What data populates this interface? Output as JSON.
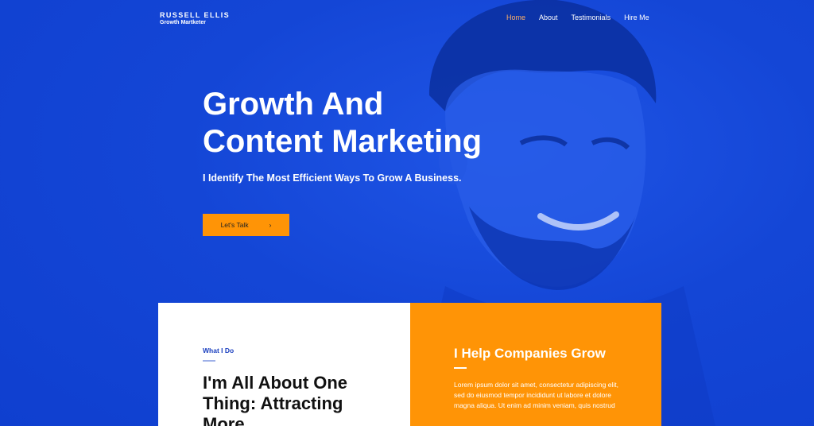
{
  "brand": {
    "name": "RUSSELL ELLIS",
    "tagline": "Growth Martketer"
  },
  "nav": {
    "items": [
      "Home",
      "About",
      "Testimonials",
      "Hire Me"
    ],
    "active": "Home"
  },
  "hero": {
    "title_line1": "Growth And",
    "title_line2": "Content Marketing",
    "subtitle": "I Identify The Most Efficient Ways To Grow A Business.",
    "cta_label": "Let's Talk",
    "cta_icon": "chevron-right-icon"
  },
  "what_i_do": {
    "label": "What I Do",
    "title": "I'm All About One Thing: Attracting More"
  },
  "help": {
    "title": "I Help Companies Grow",
    "body": "Lorem ipsum dolor sit amet, consectetur adipiscing elit, sed do eiusmod tempor incididunt ut labore et dolore magna aliqua. Ut enim ad minim veniam, quis nostrud"
  },
  "colors": {
    "primary": "#1446d6",
    "accent": "#ff9406",
    "nav_active": "#ffb066"
  }
}
